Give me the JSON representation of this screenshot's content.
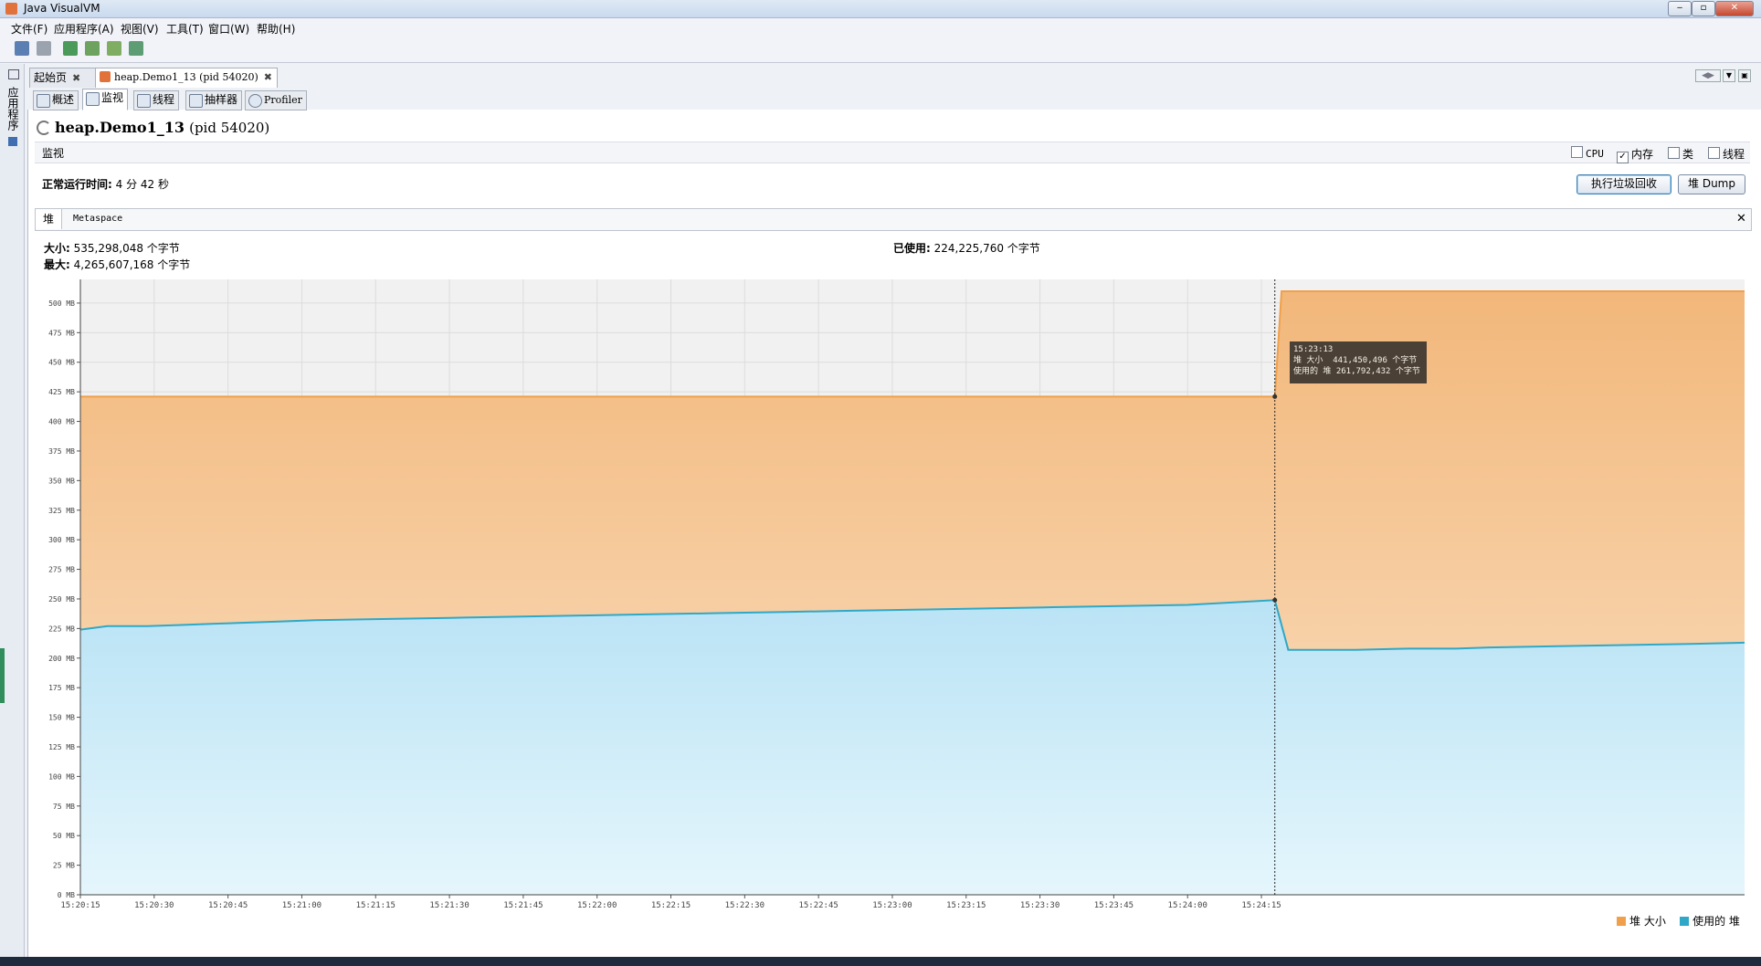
{
  "window": {
    "title": "Java VisualVM"
  },
  "menu": [
    "文件(F)",
    "应用程序(A)",
    "视图(V)",
    "工具(T)",
    "窗口(W)",
    "帮助(H)"
  ],
  "left_panel": {
    "label": "应用程序"
  },
  "tabs": [
    {
      "label": "起始页"
    },
    {
      "label": "heap.Demo1_13  (pid 54020)"
    }
  ],
  "subtabs": [
    "概述",
    "监视",
    "线程",
    "抽样器",
    "Profiler"
  ],
  "page": {
    "app_name": "heap.Demo1_13",
    "pid": "(pid 54020)",
    "section": "监视",
    "checkboxes": [
      {
        "label": "CPU",
        "checked": false
      },
      {
        "label": "内存",
        "checked": true
      },
      {
        "label": "类",
        "checked": false
      },
      {
        "label": "线程",
        "checked": false
      }
    ],
    "uptime_label": "正常运行时间:",
    "uptime_value": "4 分 42 秒",
    "gc_button": "执行垃圾回收",
    "dump_button": "堆 Dump"
  },
  "heap_panel": {
    "tabs": [
      "堆",
      "Metaspace"
    ],
    "close": "✕",
    "size_label": "大小:",
    "size_value": "535,298,048 个字节",
    "max_label": "最大:",
    "max_value": "4,265,607,168 个字节",
    "used_label": "已使用:",
    "used_value": "224,225,760 个字节",
    "tooltip": {
      "time": "15:23:13",
      "line1_label": "堆 大小",
      "line1_value": "441,450,496 个字节",
      "line2_label": "使用的 堆",
      "line2_value": "261,792,432 个字节"
    }
  },
  "chart_data": {
    "type": "area",
    "x_ticks": [
      "15:20:15",
      "15:20:30",
      "15:20:45",
      "15:21:00",
      "15:21:15",
      "15:21:30",
      "15:21:45",
      "15:22:00",
      "15:22:15",
      "15:22:30",
      "15:22:45",
      "15:23:00",
      "15:23:15",
      "15:23:30",
      "15:23:45",
      "15:24:00",
      "15:24:15"
    ],
    "y_ticks": [
      "0 MB",
      "25 MB",
      "50 MB",
      "75 MB",
      "100 MB",
      "125 MB",
      "150 MB",
      "175 MB",
      "200 MB",
      "225 MB",
      "250 MB",
      "275 MB",
      "300 MB",
      "325 MB",
      "350 MB",
      "375 MB",
      "400 MB",
      "425 MB",
      "450 MB",
      "475 MB",
      "500 MB"
    ],
    "ylim": [
      0,
      520
    ],
    "xlim": [
      0,
      248
    ],
    "series": [
      {
        "name": "堆 大小",
        "color": "#f0a04b",
        "points": [
          [
            0,
            421
          ],
          [
            178,
            421
          ],
          [
            179,
            510
          ],
          [
            248,
            510
          ]
        ]
      },
      {
        "name": "使用的 堆",
        "color": "#2fa8c7",
        "points": [
          [
            0,
            224
          ],
          [
            4,
            227
          ],
          [
            10,
            227
          ],
          [
            15,
            228
          ],
          [
            20,
            229
          ],
          [
            25,
            230
          ],
          [
            30,
            231
          ],
          [
            35,
            232
          ],
          [
            45,
            233
          ],
          [
            55,
            234
          ],
          [
            65,
            235
          ],
          [
            75,
            236
          ],
          [
            85,
            237
          ],
          [
            95,
            238
          ],
          [
            105,
            239
          ],
          [
            115,
            240
          ],
          [
            125,
            241
          ],
          [
            135,
            242
          ],
          [
            145,
            243
          ],
          [
            155,
            244
          ],
          [
            165,
            245
          ],
          [
            178,
            249
          ],
          [
            180,
            207
          ],
          [
            190,
            207
          ],
          [
            198,
            208
          ],
          [
            205,
            208
          ],
          [
            210,
            209
          ],
          [
            220,
            210
          ],
          [
            230,
            211
          ],
          [
            240,
            212
          ],
          [
            248,
            213
          ]
        ]
      }
    ],
    "marker_x": 178,
    "legend": [
      "堆 大小",
      "使用的 堆"
    ],
    "legend_position": "bottom-right",
    "grid": true
  }
}
